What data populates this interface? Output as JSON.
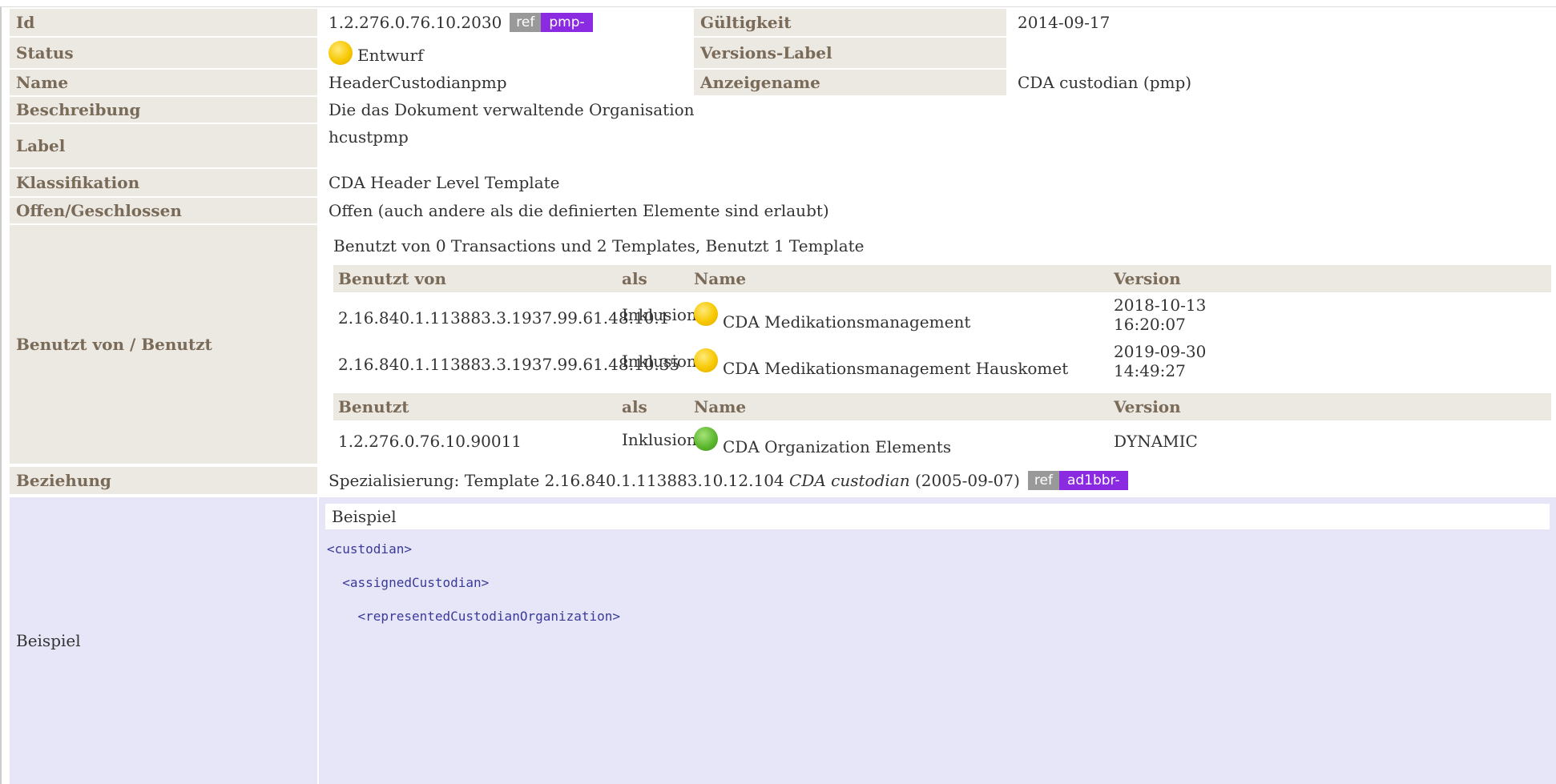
{
  "rows": {
    "id": {
      "label": "Id",
      "value": "1.2.276.0.76.10.2030",
      "ref": "ref",
      "prefix": "pmp-"
    },
    "gueltigkeit": {
      "label": "Gültigkeit",
      "value": "2014-09-17"
    },
    "status": {
      "label": "Status",
      "value": "Entwurf",
      "icon": "status-draft-yellow-icon"
    },
    "versions_label": {
      "label": "Versions-Label",
      "value": ""
    },
    "name": {
      "label": "Name",
      "value": "HeaderCustodianpmp"
    },
    "anzeigename": {
      "label": "Anzeigename",
      "value": "CDA custodian (pmp)"
    },
    "beschreibung": {
      "label": "Beschreibung",
      "value": "Die das Dokument verwaltende Organisation"
    },
    "label": {
      "label": "Label",
      "value": "hcustpmp"
    },
    "klassifikation": {
      "label": "Klassifikation",
      "value": "CDA Header Level Template"
    },
    "offen": {
      "label": "Offen/Geschlossen",
      "value": "Offen (auch andere als die definierten Elemente sind erlaubt)"
    },
    "benutzt": {
      "label": "Benutzt von / Benutzt",
      "summary": "Benutzt von 0 Transactions und 2 Templates, Benutzt 1 Template",
      "used_by_headers": [
        "Benutzt von",
        "als",
        "Name",
        "Version"
      ],
      "used_by": [
        {
          "id": "2.16.840.1.113883.3.1937.99.61.48.10.1",
          "as": "Inklusion",
          "status": "yellow",
          "name": "CDA Medikationsmanagement",
          "version_line1": "2018-10-13",
          "version_line2": "16:20:07"
        },
        {
          "id": "2.16.840.1.113883.3.1937.99.61.48.10.35",
          "as": "Inklusion",
          "status": "yellow",
          "name": "CDA Medikationsmanagement Hauskomet",
          "version_line1": "2019-09-30",
          "version_line2": "14:49:27"
        }
      ],
      "uses_headers": [
        "Benutzt",
        "als",
        "Name",
        "Version"
      ],
      "uses": [
        {
          "id": "1.2.276.0.76.10.90011",
          "as": "Inklusion",
          "status": "green",
          "name": "CDA Organization Elements",
          "version": "DYNAMIC"
        }
      ]
    },
    "beziehung": {
      "label": "Beziehung",
      "prefix_text": "Spezialisierung: Template 2.16.840.1.113883.10.12.104",
      "italic_name": "CDA custodian",
      "date": "(2005-09-07)",
      "ref": "ref",
      "prefix": "ad1bbr-"
    },
    "beispiel": {
      "label": "Beispiel",
      "box_title": "Beispiel",
      "code_lines": [
        "<custodian>",
        "  <assignedCustodian>",
        "    <representedCustodianOrganization>"
      ]
    }
  },
  "colors": {
    "label_bg": "#ece9e3",
    "label_text": "#7a6a58",
    "prefix_badge": "#8a2be2",
    "ref_badge": "#999999",
    "example_bg": "#e6e6f8"
  }
}
